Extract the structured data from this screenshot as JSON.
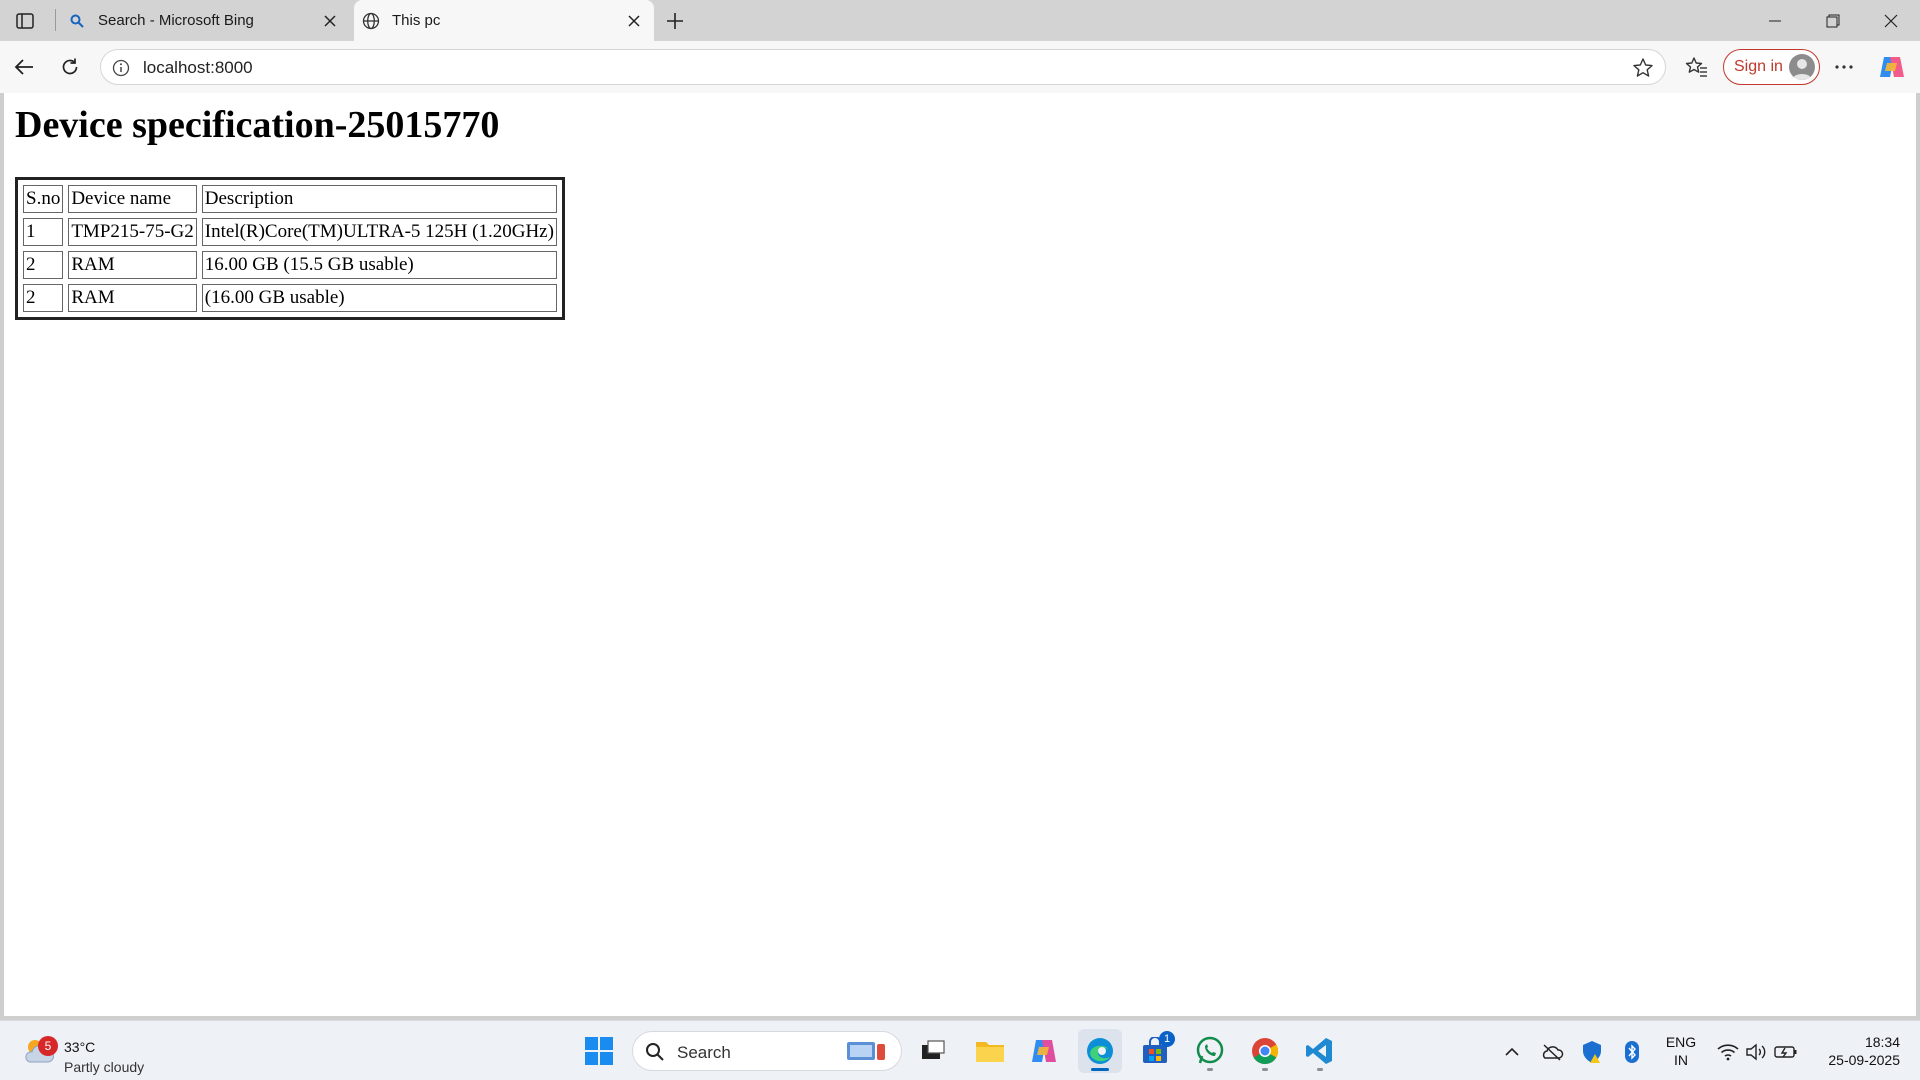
{
  "browser": {
    "tabs": [
      {
        "title": "Search - Microsoft Bing",
        "icon": "search-icon",
        "active": false
      },
      {
        "title": "This pc",
        "icon": "globe-icon",
        "active": true
      }
    ],
    "address": "localhost:8000",
    "signin_label": "Sign in"
  },
  "page": {
    "title": "Device specification-25015770",
    "table": {
      "headers": [
        "S.no",
        "Device name",
        "Description"
      ],
      "rows": [
        [
          "1",
          "TMP215-75-G2",
          "Intel(R)Core(TM)ULTRA-5 125H (1.20GHz)"
        ],
        [
          "2",
          "RAM",
          "16.00 GB (15.5 GB usable)"
        ],
        [
          "2",
          "RAM",
          "(16.00 GB usable)"
        ]
      ]
    }
  },
  "taskbar": {
    "weather": {
      "badge": "5",
      "temp": "33°C",
      "condition": "Partly cloudy"
    },
    "search_label": "Search",
    "store_badge": "1",
    "lang": [
      "ENG",
      "IN"
    ],
    "time": "18:34",
    "date": "25-09-2025"
  },
  "colors": {
    "accent": "#0067c0",
    "signin": "#c0392b",
    "edge_blue": "#0c8fd6",
    "vscode_blue": "#1f8ad2"
  }
}
